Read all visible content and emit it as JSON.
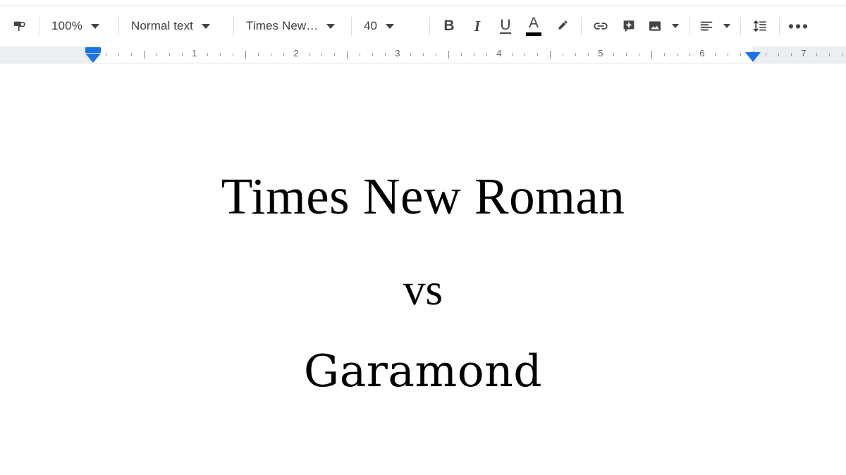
{
  "app": {
    "name": "Google Docs",
    "surface": "document-editor"
  },
  "toolbar": {
    "paint_format": {
      "label": "Paint format",
      "icon": "paint-roller-icon"
    },
    "zoom": {
      "value": "100%",
      "icon": "chevron-down-icon"
    },
    "paragraph_style": {
      "value": "Normal text",
      "icon": "chevron-down-icon"
    },
    "font": {
      "value": "Times New…",
      "icon": "chevron-down-icon"
    },
    "font_size": {
      "value": "40",
      "icon": "chevron-down-icon"
    },
    "bold": {
      "label": "B"
    },
    "italic": {
      "label": "I"
    },
    "underline": {
      "label": "U"
    },
    "text_color": {
      "label": "A",
      "swatch": "#000000"
    },
    "highlight": {
      "label": "Highlight color",
      "icon": "highlighter-pen-icon"
    },
    "insert_link": {
      "label": "Insert link",
      "icon": "link-icon"
    },
    "add_comment": {
      "label": "Add comment",
      "icon": "comment-plus-icon"
    },
    "insert_image": {
      "label": "Insert image",
      "icon": "image-icon"
    },
    "align": {
      "label": "Align",
      "icon": "align-left-icon"
    },
    "line_spacing": {
      "label": "Line & paragraph spacing",
      "icon": "line-spacing-icon"
    },
    "more": {
      "label": "More",
      "icon": "ellipsis-icon"
    }
  },
  "ruler": {
    "numbers": [
      "1",
      "2",
      "3",
      "4",
      "5",
      "6",
      "7"
    ],
    "left_indent_marker": "left-indent-marker",
    "right_margin_marker": "right-margin-marker",
    "margin_color": "#eceff1",
    "marker_color": "#1a73e8"
  },
  "document": {
    "lines": [
      {
        "text": "Times New Roman",
        "style": "line-tnr"
      },
      {
        "text": "vs",
        "style": "line-vs"
      },
      {
        "text": "Garamond",
        "style": "line-gara"
      }
    ]
  }
}
